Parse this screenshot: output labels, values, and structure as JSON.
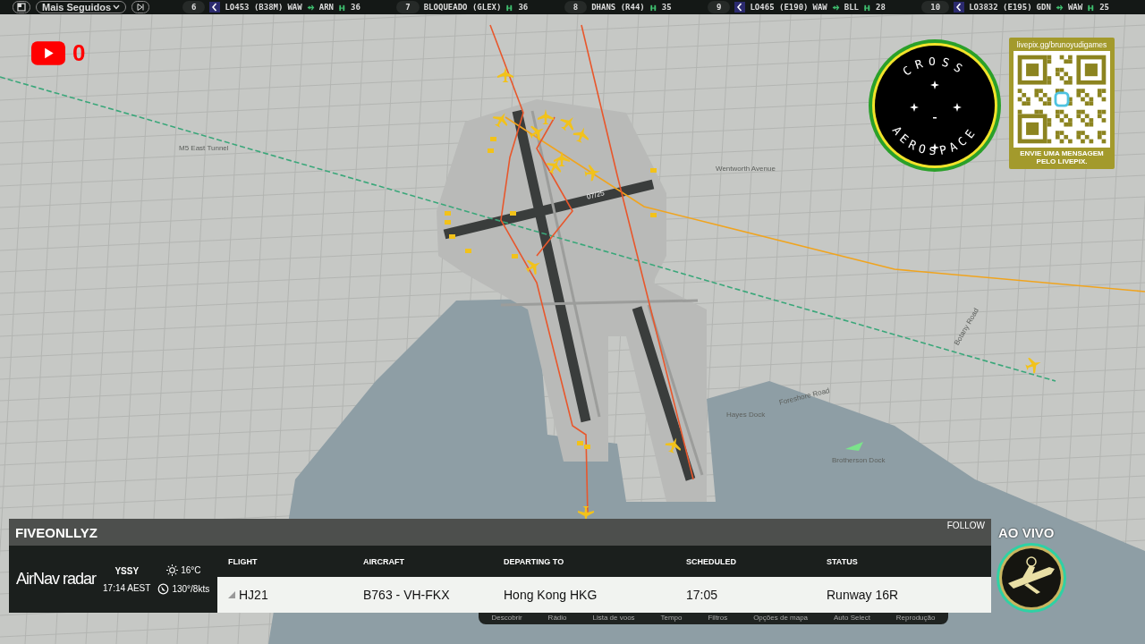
{
  "top_bar": {
    "menu_label": "Mais Seguidos",
    "ranking": [
      {
        "rank": "6",
        "logo": true,
        "callsign": "LO453 (B38M)",
        "from": "WAW",
        "to": "ARN",
        "count": "36"
      },
      {
        "rank": "7",
        "logo": false,
        "callsign": "BLOQUEADO (GLEX)",
        "count": "36"
      },
      {
        "rank": "8",
        "logo": false,
        "callsign": "DHANS (R44)",
        "count": "35"
      },
      {
        "rank": "9",
        "logo": true,
        "callsign": "LO465 (E190)",
        "from": "WAW",
        "to": "BLL",
        "count": "28"
      },
      {
        "rank": "10",
        "logo": true,
        "callsign": "LO3832 (E195)",
        "from": "GDN",
        "to": "WAW",
        "count": "25"
      }
    ]
  },
  "stream": {
    "youtube_count": "0",
    "live_label": "AO VIVO"
  },
  "cross_logo": {
    "top_text": "CROSS",
    "bottom_text": "AEROSPACE"
  },
  "livepix": {
    "url": "livepix.gg/brunoyudigames",
    "caption": "ENVIE UMA MENSAGEM PELO LIVEPIX."
  },
  "map_labels": [
    "M5 East Tunnel",
    "07/25",
    "Wentworth Avenue",
    "Foreshore Road",
    "Botany Road",
    "Hayes Dock",
    "Brotherson Dock"
  ],
  "flight_panel": {
    "name": "FIVEONLLYZ",
    "follow": "FOLLOW",
    "brand": "AirNav radar",
    "airport": "YSSY",
    "time": "17:14 AEST",
    "temperature": "16°C",
    "wind": "130°/8kts",
    "columns": [
      "FLIGHT",
      "AIRCRAFT",
      "DEPARTING TO",
      "SCHEDULED",
      "STATUS"
    ],
    "values": [
      "HJ21",
      "B763 - VH-FKX",
      "Hong Kong HKG",
      "17:05",
      "Runway 16R"
    ]
  },
  "bottom_menu": [
    "Descobrir",
    "Rádio",
    "Lista de voos",
    "Tempo",
    "Filtros",
    "Opções de mapa",
    "Auto Select",
    "Reprodução"
  ]
}
